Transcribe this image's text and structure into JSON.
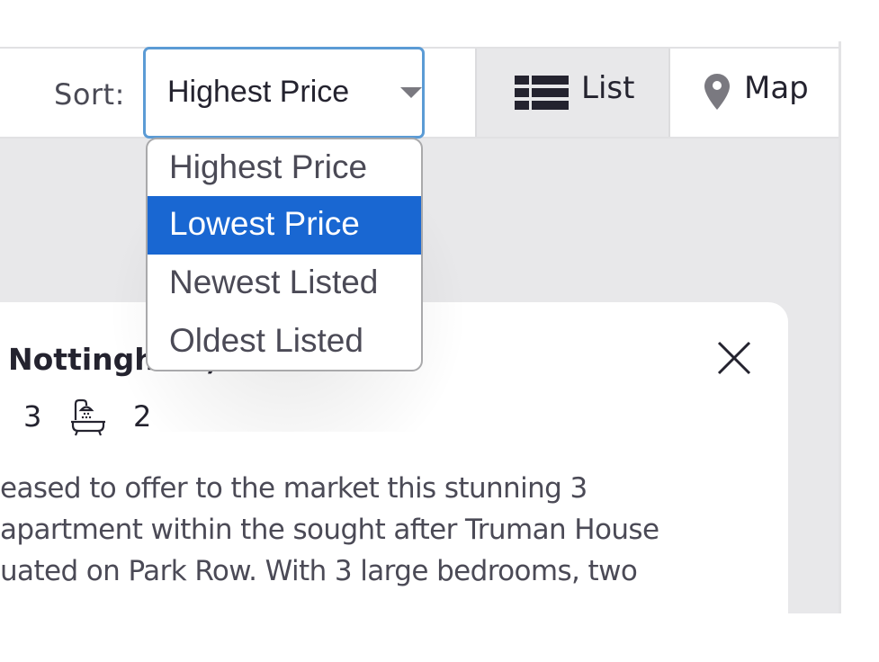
{
  "toolbar": {
    "sort_label": "Sort:",
    "sort_selected": "Highest Price",
    "views": [
      {
        "label": "List",
        "icon": "list-icon",
        "active": true
      },
      {
        "label": "Map",
        "icon": "map-pin-icon",
        "active": false
      }
    ]
  },
  "sort_dropdown": {
    "options": [
      {
        "label": "Highest Price",
        "highlighted": false
      },
      {
        "label": "Lowest Price",
        "highlighted": true
      },
      {
        "label": "Newest Listed",
        "highlighted": false
      },
      {
        "label": "Oldest Listed",
        "highlighted": false
      }
    ],
    "highlight_color": "#1967d2"
  },
  "listing": {
    "title_visible": "Nottingham,",
    "bedrooms": "3",
    "bathrooms": "2",
    "description_lines": [
      "eased to offer to the market this stunning 3",
      " apartment within the sought after Truman House",
      "uated on Park Row. With 3 large bedrooms, two"
    ]
  },
  "colors": {
    "focus_border": "#5b9bd5",
    "active_view_bg": "#e8e8ea",
    "text_dark": "#24232f"
  }
}
